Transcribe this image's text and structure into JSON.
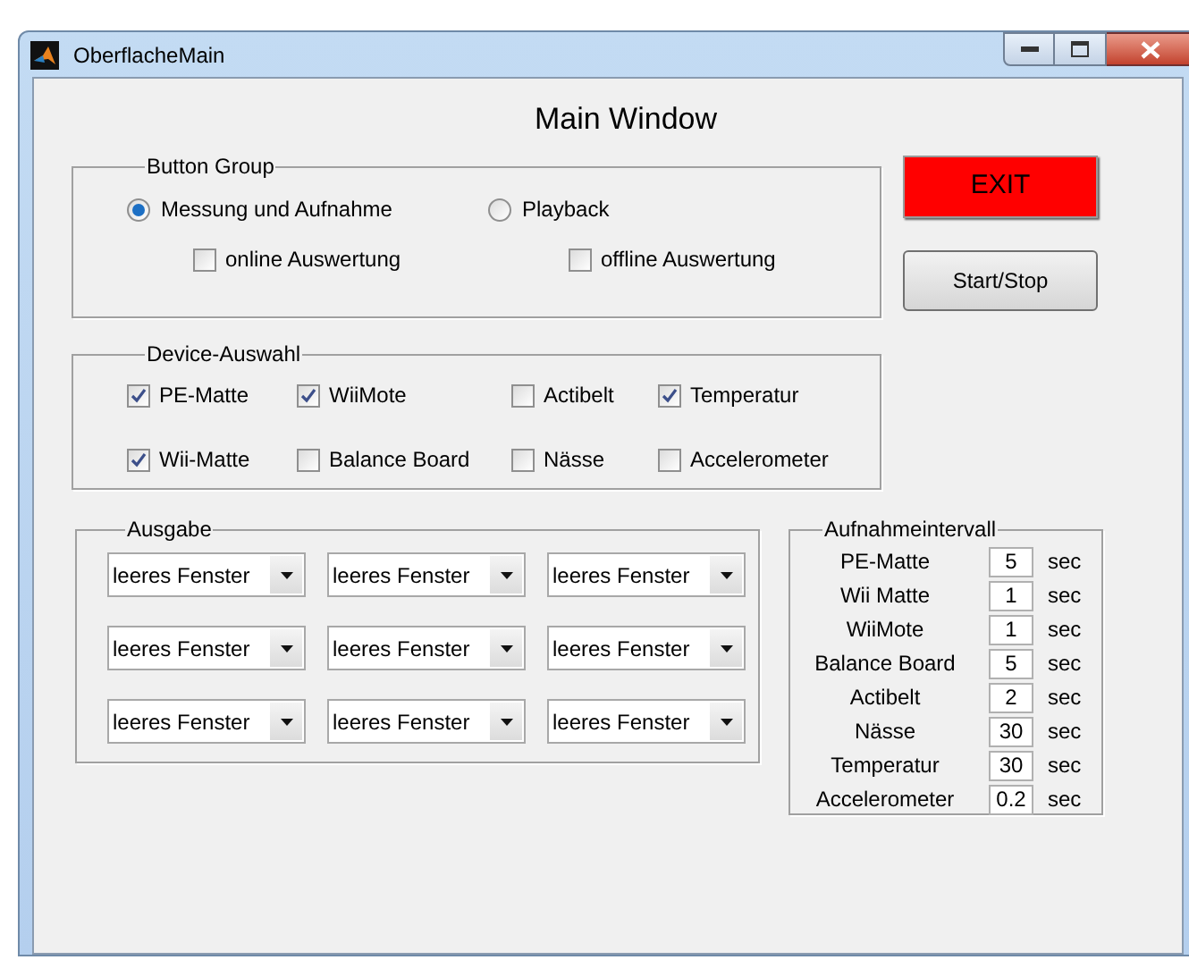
{
  "window": {
    "title": "OberflacheMain"
  },
  "heading": "Main Window",
  "button_group": {
    "title": "Button Group",
    "radios": [
      {
        "label": "Messung und Aufnahme",
        "selected": true
      },
      {
        "label": "Playback",
        "selected": false
      }
    ],
    "checkboxes": [
      {
        "label": "online Auswertung",
        "checked": false
      },
      {
        "label": "offline Auswertung",
        "checked": false
      }
    ]
  },
  "buttons": [
    {
      "kind": "exit",
      "label": "EXIT"
    },
    {
      "kind": "normal",
      "label": "Start/Stop"
    }
  ],
  "device_selection": {
    "title": "Device-Auswahl",
    "items": [
      {
        "label": "PE-Matte",
        "checked": true
      },
      {
        "label": "WiiMote",
        "checked": true
      },
      {
        "label": "Actibelt",
        "checked": false
      },
      {
        "label": "Temperatur",
        "checked": true
      },
      {
        "label": "Wii-Matte",
        "checked": true
      },
      {
        "label": "Balance Board",
        "checked": false
      },
      {
        "label": "Nässe",
        "checked": false
      },
      {
        "label": "Accelerometer",
        "checked": false
      }
    ]
  },
  "output": {
    "title": "Ausgabe",
    "dropdowns": [
      "leeres Fenster",
      "leeres Fenster",
      "leeres Fenster",
      "leeres Fenster",
      "leeres Fenster",
      "leeres Fenster",
      "leeres Fenster",
      "leeres Fenster",
      "leeres Fenster"
    ]
  },
  "interval": {
    "title": "Aufnahmeintervall",
    "rows": [
      {
        "label": "PE-Matte",
        "value": "5",
        "unit": "sec"
      },
      {
        "label": "Wii Matte",
        "value": "1",
        "unit": "sec"
      },
      {
        "label": "WiiMote",
        "value": "1",
        "unit": "sec"
      },
      {
        "label": "Balance Board",
        "value": "5",
        "unit": "sec"
      },
      {
        "label": "Actibelt",
        "value": "2",
        "unit": "sec"
      },
      {
        "label": "Nässe",
        "value": "30",
        "unit": "sec"
      },
      {
        "label": "Temperatur",
        "value": "30",
        "unit": "sec"
      },
      {
        "label": "Accelerometer",
        "value": "0.2",
        "unit": "sec"
      }
    ]
  }
}
